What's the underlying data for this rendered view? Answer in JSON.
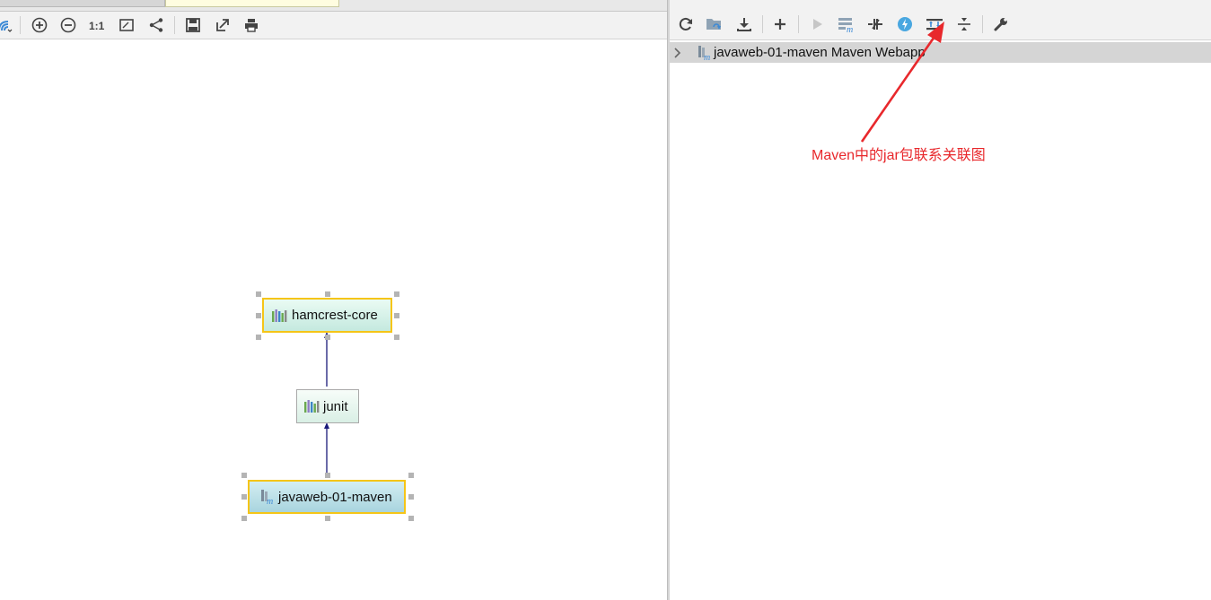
{
  "diagram": {
    "nodes": [
      {
        "label": "hamcrest-core"
      },
      {
        "label": "junit"
      },
      {
        "label": "javaweb-01-maven"
      }
    ]
  },
  "maven_panel": {
    "tree": [
      {
        "label": "javaweb-01-maven Maven Webapp"
      }
    ]
  },
  "annotation": {
    "text": "Maven中的jar包联系关联图",
    "color": "#e8282c"
  },
  "colors": {
    "selection_border": "#f5c518",
    "edge": "#1a1a7a",
    "accent_blue": "#3d8ad6"
  },
  "icons": {
    "left_toolbar": [
      "show-dependencies-icon",
      "zoom-in-icon",
      "zoom-out-icon",
      "actual-size-icon",
      "fit-content-icon",
      "layout-icon",
      "save-icon",
      "export-icon",
      "print-icon"
    ],
    "right_toolbar": [
      "reimport-icon",
      "generate-sources-icon",
      "download-icon",
      "add-icon",
      "run-icon",
      "execute-goal-icon",
      "toggle-offline-icon",
      "skip-tests-icon",
      "show-dependencies-icon",
      "collapse-all-icon",
      "settings-icon"
    ]
  }
}
